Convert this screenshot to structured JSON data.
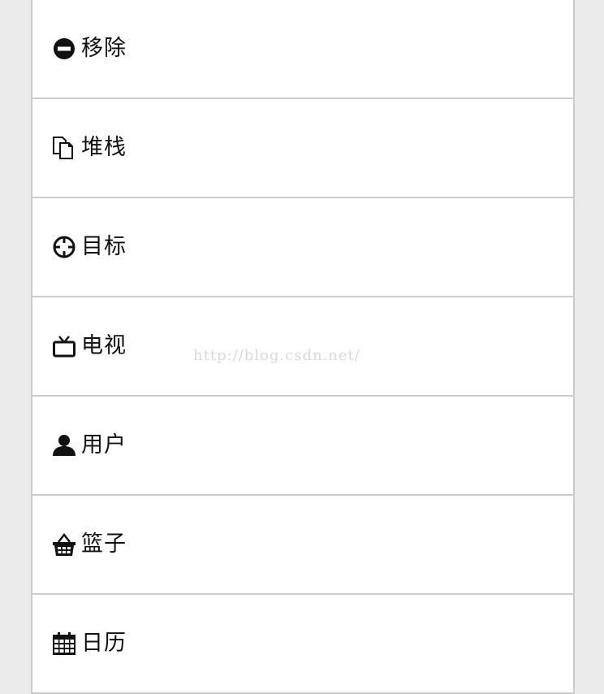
{
  "list": {
    "items": [
      {
        "icon": "minus-circle-icon",
        "label": "移除"
      },
      {
        "icon": "stack-icon",
        "label": "堆栈"
      },
      {
        "icon": "target-icon",
        "label": "目标"
      },
      {
        "icon": "tv-icon",
        "label": "电视"
      },
      {
        "icon": "user-icon",
        "label": "用户"
      },
      {
        "icon": "basket-icon",
        "label": "篮子"
      },
      {
        "icon": "calendar-icon",
        "label": "日历"
      }
    ]
  },
  "watermark": {
    "text": "http://blog.csdn.net/"
  },
  "colors": {
    "background": "#ebebeb",
    "panel": "#ffffff",
    "border": "#cccccc",
    "text": "#111111",
    "watermark": "#d9d9d9"
  }
}
